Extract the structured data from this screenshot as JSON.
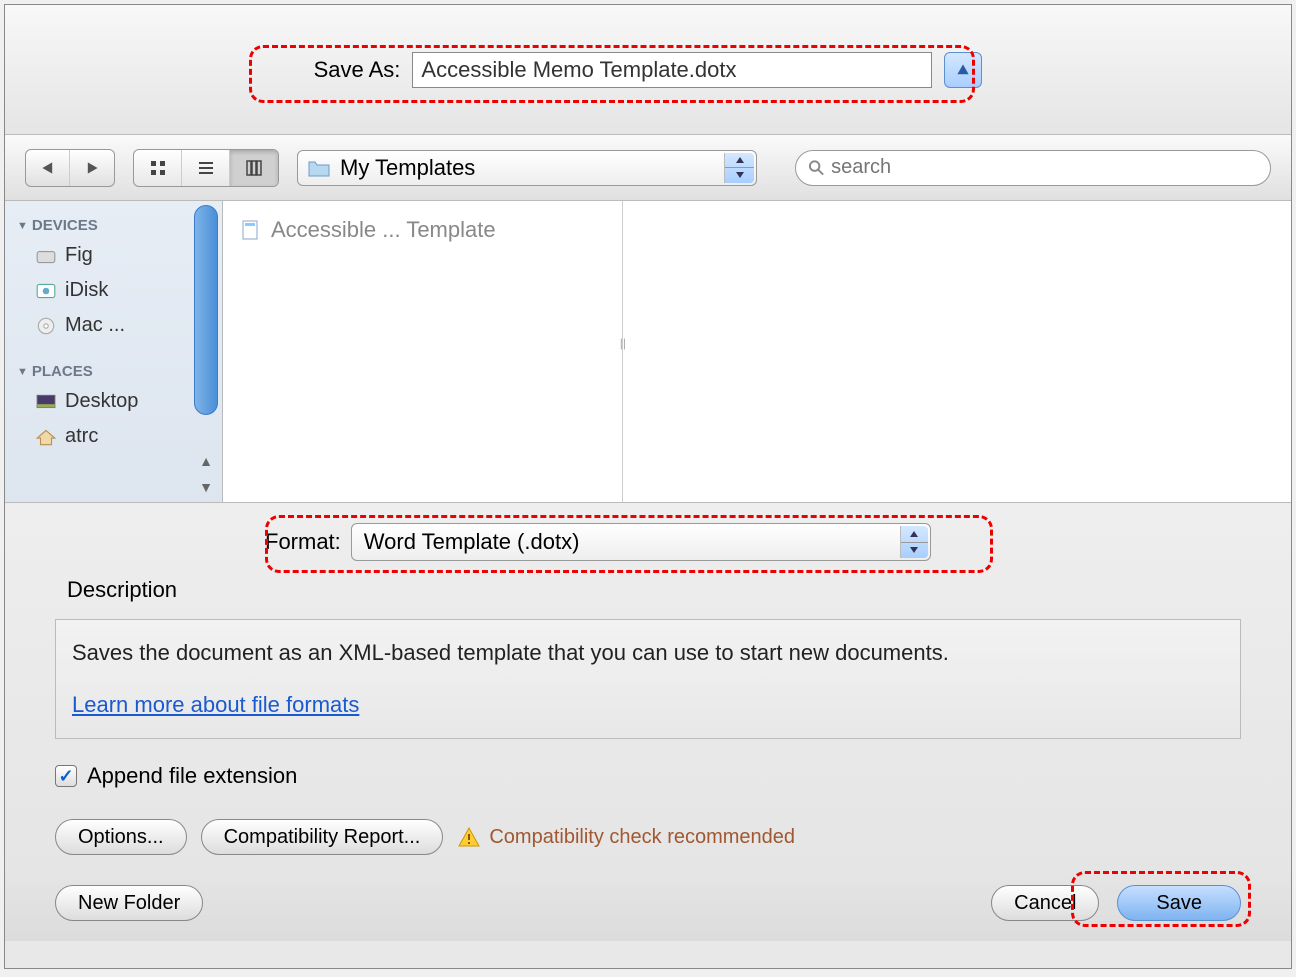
{
  "saveAs": {
    "label": "Save As:",
    "filename": "Accessible Memo Template.dotx"
  },
  "toolbar": {
    "location": "My Templates",
    "searchPlaceholder": "search"
  },
  "sidebar": {
    "devices": {
      "header": "DEVICES",
      "items": [
        "Fig",
        "iDisk",
        "Mac ..."
      ]
    },
    "places": {
      "header": "PLACES",
      "items": [
        "Desktop",
        "atrc"
      ]
    }
  },
  "files": {
    "item1": "Accessible ... Template"
  },
  "format": {
    "label": "Format:",
    "value": "Word Template (.dotx)",
    "descriptionLabel": "Description",
    "descriptionText": "Saves the document as an XML-based template that you can use to start new documents.",
    "learnLink": "Learn more about file formats",
    "appendExt": "Append file extension",
    "optionsBtn": "Options...",
    "compatBtn": "Compatibility Report...",
    "compatWarn": "Compatibility check recommended"
  },
  "footer": {
    "newFolder": "New Folder",
    "cancel": "Cancel",
    "save": "Save"
  }
}
